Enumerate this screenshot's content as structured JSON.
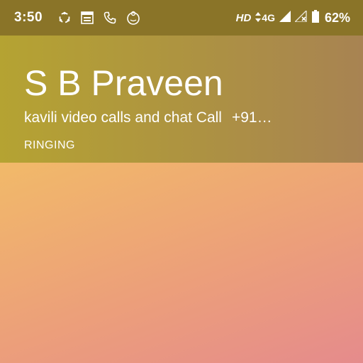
{
  "status_bar": {
    "time": "3:50",
    "icons": [
      "sync-icon",
      "calendar-app-icon",
      "phone-icon",
      "baby-icon"
    ],
    "hd": "HD",
    "network": "4G",
    "battery": "62%"
  },
  "call": {
    "caller_name": "S B Praveen",
    "app_label": "kavili video calls and chat Call",
    "number": "+91…",
    "status": "RINGING"
  },
  "colors": {
    "status_bar_bg": "#8a7428",
    "header_bg": "#ad9242",
    "gradient_top": "#f4cf59",
    "gradient_bottom": "#e58b8c"
  }
}
